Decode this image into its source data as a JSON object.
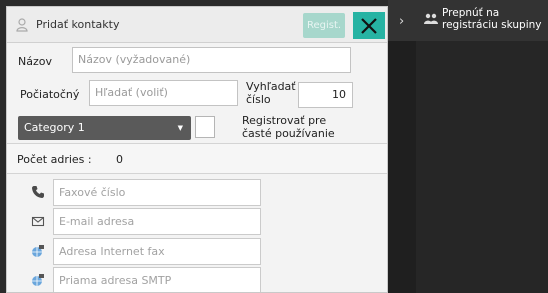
{
  "dialog": {
    "title": "Pridať kontakty",
    "regist_label": "Regist.",
    "close_label": "X"
  },
  "form": {
    "name_label": "Názov",
    "name_placeholder": "Názov (vyžadované)",
    "initial_label": "Počiatočný",
    "initial_placeholder": "Hľadať (voliť)",
    "search_number_label_line1": "Vyhľadať",
    "search_number_label_line2": "číslo",
    "search_number_value": "10",
    "category_value": "Category 1",
    "favorite_label_line1": "Registrovať pre",
    "favorite_label_line2": "časté používanie",
    "favorite_checked": false,
    "address_count_label": "Počet adries :",
    "address_count_value": "0"
  },
  "addresses": {
    "fax_placeholder": "Faxové číslo",
    "email_placeholder": "E-mail adresa",
    "ifax_placeholder": "Adresa Internet fax",
    "smtp_placeholder": "Priama adresa SMTP"
  },
  "side_panel": {
    "switch_label_line1": "Prepnúť na",
    "switch_label_line2": "registráciu skupiny"
  },
  "colors": {
    "accent": "#26b3a3",
    "accent_disabled": "#a7d7cc",
    "select_bg": "#5a5a5a",
    "panel_bg": "#1f1f1f"
  },
  "icons": {
    "title": "person-icon",
    "fax": "phone-icon",
    "email": "envelope-icon",
    "ifax": "globe-fax-icon",
    "smtp": "globe-mail-icon",
    "side": "group-icon",
    "chevron": "chevron-right-icon"
  }
}
